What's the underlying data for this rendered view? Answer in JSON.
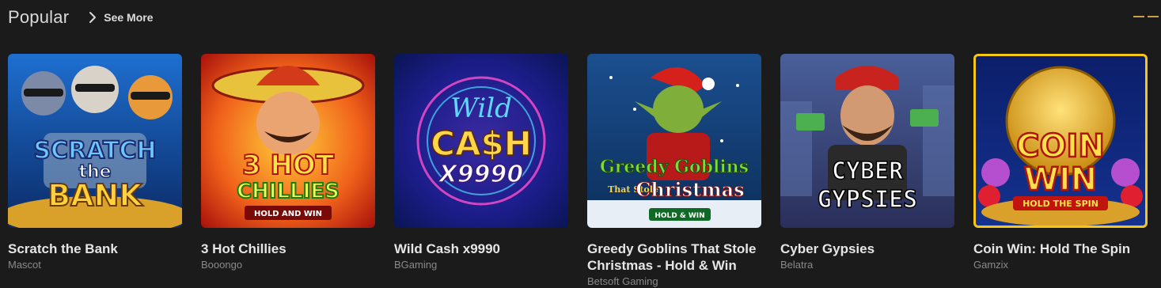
{
  "section": {
    "title": "Popular",
    "see_more_label": "See More"
  },
  "colors": {
    "background": "#1b1b1b",
    "accent": "#f5c518",
    "indicator": "#c9a047"
  },
  "games": [
    {
      "name": "Scratch the Bank",
      "provider": "Mascot",
      "art_text": [
        "SCRATCH",
        "the",
        "BANK"
      ]
    },
    {
      "name": "3 Hot Chillies",
      "provider": "Booongo",
      "art_text": [
        "3 HOT",
        "CHILLIES",
        "HOLD AND WIN"
      ]
    },
    {
      "name": "Wild Cash x9990",
      "provider": "BGaming",
      "art_text": [
        "Wild",
        "CA$H",
        "X9990"
      ]
    },
    {
      "name": "Greedy Goblins That Stole Christmas - Hold & Win",
      "provider": "Betsoft Gaming",
      "art_text": [
        "Greedy Goblins",
        "That Stole",
        "Christmas",
        "HOLD & WIN"
      ]
    },
    {
      "name": "Cyber Gypsies",
      "provider": "Belatra",
      "art_text": [
        "CYBER",
        "GYPSIES"
      ]
    },
    {
      "name": "Coin Win: Hold The Spin",
      "provider": "Gamzix",
      "art_text": [
        "COIN",
        "WIN",
        "HOLD THE SPIN"
      ]
    }
  ]
}
